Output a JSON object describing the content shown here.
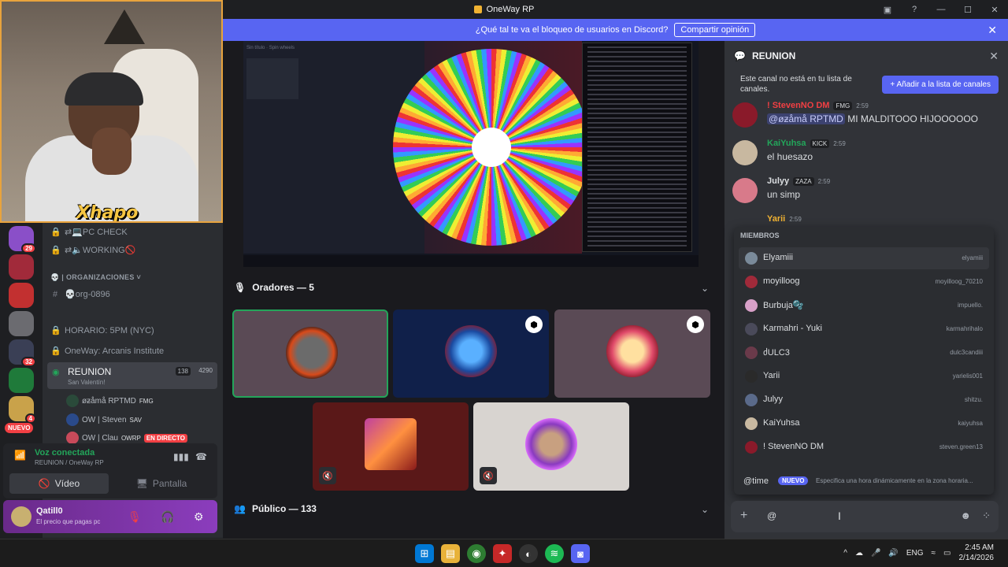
{
  "window": {
    "title": "OneWay RP"
  },
  "banner": {
    "text": "¿Qué tal te va el bloqueo de usuarios en Discord?",
    "button": "Compartir opinión"
  },
  "webcam": {
    "overlay_text": "Xhapo"
  },
  "server_rail": {
    "badges": [
      "29",
      "32",
      "4"
    ],
    "new_label": "NUEVO"
  },
  "channels": {
    "items": [
      {
        "label": "⇄💻PC CHECK"
      },
      {
        "label": "⇄🔈WORKING🚫"
      }
    ],
    "category": "ORGANIZACIONES",
    "org_channel": "💀org-0896",
    "horario": "HORARIO: 5PM (NYC)",
    "institute": "OneWay: Arcanis Institute",
    "voice_channel": {
      "name": "REUNION",
      "sub": "San Valentín!",
      "live_count": "138",
      "user_count": "4290"
    },
    "voice_users": [
      {
        "name": "øƶåmå RPTMD",
        "tag": "FMG"
      },
      {
        "name": "OW | Steven",
        "tag": "SAV"
      },
      {
        "name": "OW | Clau",
        "tag": "OWRP",
        "live": "EN DIRECTO"
      }
    ]
  },
  "voice_panel": {
    "status": "Voz conectada",
    "location": "REUNION / OneWay RP",
    "video_label": "Vídeo",
    "screen_label": "Pantalla"
  },
  "user": {
    "name": "Qatill0",
    "status": "El precio que pagas pc"
  },
  "stage": {
    "speakers_label": "Oradores — 5",
    "audience_label": "Público — 133",
    "screen_labels": [
      "Sin título",
      "Spin wheels"
    ]
  },
  "right_panel": {
    "title": "REUNION",
    "notice": "Este canal no está en tu lista de canales.",
    "add_button": "Añadir a la lista de canales",
    "messages": [
      {
        "author": "! StevenNO DM",
        "tag": "FMG",
        "time": "2:59",
        "mention": "@øƶåmå RPTMD",
        "text": "MI MALDITOOO HIJOOOOOO"
      },
      {
        "author": "KaiYuhsa",
        "tag": "KICK",
        "time": "2:59",
        "text": "el huesazo"
      },
      {
        "author": "Julyy",
        "tag": "ZAZA",
        "time": "2:59",
        "text": "un simp"
      },
      {
        "author": "Yarii",
        "time": "2:59",
        "text": ""
      }
    ],
    "members_header": "MIEMBROS",
    "members": [
      {
        "name": "Elyamiii",
        "user": "elyamiii"
      },
      {
        "name": "moyilloog",
        "user": "moyilloog_70210"
      },
      {
        "name": "Burbuja🫧",
        "user": "impuello."
      },
      {
        "name": "Karmahri - Yuki",
        "user": "karmahrihalo"
      },
      {
        "name": "ძULC3",
        "user": "dulc3candiii"
      },
      {
        "name": "Yarii",
        "user": "yarielis001"
      },
      {
        "name": "Julyy",
        "user": "shitzu."
      },
      {
        "name": "KaiYuhsa",
        "user": "kaiyuhsa"
      },
      {
        "name": "! StevenNO DM",
        "user": "steven.green13"
      }
    ],
    "command": {
      "name": "@time",
      "badge": "NUEVO",
      "desc": "Especifica una hora dinámicamente en la zona horaria..."
    },
    "input_value": "@"
  },
  "taskbar": {
    "lang": "ENG",
    "time": "2:45 AM",
    "date": "2/14/2026"
  },
  "colors": {
    "accent": "#5865f2",
    "online": "#23a55a",
    "danger": "#f23f43"
  }
}
